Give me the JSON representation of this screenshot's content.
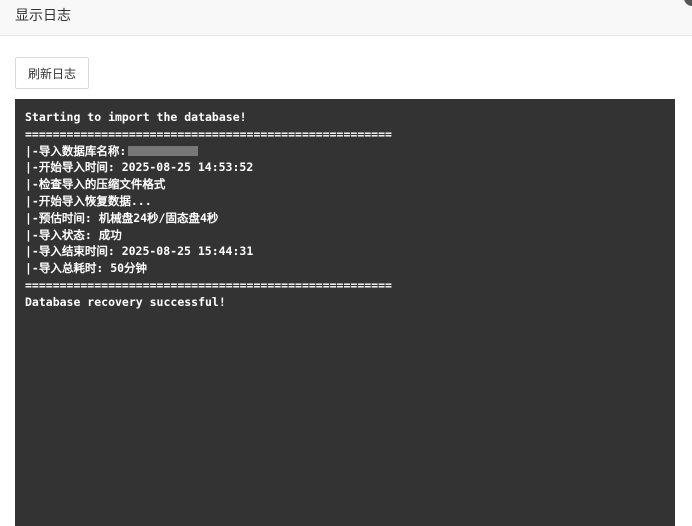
{
  "dialog": {
    "title": "显示日志"
  },
  "toolbar": {
    "refresh_label": "刷新日志"
  },
  "log": {
    "start": "Starting to import the database!",
    "separator": "=====================================================",
    "db_name_label": "|-导入数据库名称:",
    "start_time": "|-开始导入时间: 2025-08-25 14:53:52",
    "check_format": "|-检查导入的压缩文件格式",
    "restoring": "|-开始导入恢复数据...",
    "estimate": "|-预估时间: 机械盘24秒/固态盘4秒",
    "status": "|-导入状态: 成功",
    "end_time": "|-导入结束时间: 2025-08-25 15:44:31",
    "total_time": "|-导入总耗时: 50分钟",
    "result": "Database recovery successful!"
  }
}
